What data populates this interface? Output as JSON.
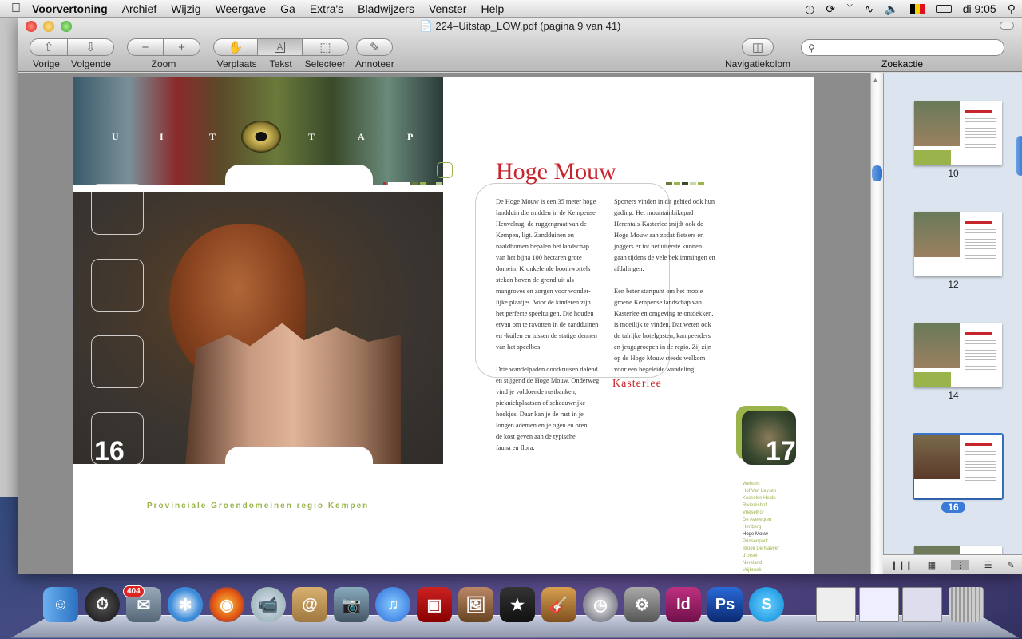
{
  "menubar": {
    "app_name": "Voorvertoning",
    "items": [
      "Archief",
      "Wijzig",
      "Weergave",
      "Ga",
      "Extra's",
      "Bladwijzers",
      "Venster",
      "Help"
    ],
    "clock": "di 9:05"
  },
  "window": {
    "title": "224–Uitstap_LOW.pdf (pagina 9 van 41)"
  },
  "toolbar": {
    "prev_label": "Vorige",
    "next_label": "Volgende",
    "zoom_label": "Zoom",
    "move_label": "Verplaats",
    "text_label": "Tekst",
    "select_label": "Selecteer",
    "annotate_label": "Annoteer",
    "sidebar_label": "Navigatiekolom",
    "search_label": "Zoekactie",
    "search_value": ""
  },
  "left_page": {
    "banner_letters": [
      "U",
      "I",
      "T",
      "S",
      "T",
      "A",
      "P"
    ],
    "page_number": "16",
    "footer": "Provinciale Groendomeinen regio Kempen"
  },
  "right_page": {
    "title": "Hoge Mouw",
    "col1": "De Hoge Mouw is een 35 meter hoge\nlandduin die midden in de Kempense\nHeuvelrug, de ruggengraat van de\nKempen, ligt. Zandduinen en\nnaaldbomen bepalen het landschap\nvan het bijna 100 hectaren grote\ndomein. Kronkelende boomwortels\nsteken boven de grond uit als\nmangroves en zorgen voor wonder-\nlijke plaatjes. Voor de kinderen zijn\nhet perfecte speeltuigen. Die houden\nervan om te ravotten in de zandduinen\nen -kuilen en tussen de statige dennen\nvan het speelbos.\n\nDrie wandelpaden doorkruisen dalend\nen stijgend de Hoge Mouw. Onderweg\nvind je voldoende rustbanken,\npicknickplaatsen of schaduwrijke\nhoekjes. Daar kan je de rust in je\nlongen ademen en je ogen en oren\nde kost geven aan de typische\nfauna en flora.",
    "col2": "Sporters vinden in dit gebied ook hun\ngading. Het  mountainbikepad\nHerentals-Kasterlee snijdt ook de\nHoge Mouw aan zodat fietsers en\njoggers er tot het uiterste kunnen\ngaan tijdens de vele beklimmingen en\nafdalingen.\n\nEen beter startpunt om het mooie\ngroene Kempense landschap van\nKasterlee en omgeving te ontdekken,\nis moeilijk te vinden. Dat weten ook\nde talrijke hotelgasten, kampeerders\nen jeugdgroepen in de regio. Zij zijn\nop de Hoge Mouw steeds welkom\nvoor een begeleide wandeling.",
    "location": "Kasterlee",
    "page_number": "17",
    "nav_items": [
      "Welkom",
      "Hof Van Leysen",
      "Kesselse Heide",
      "Riviereshof",
      "Vrieselhof",
      "De Averegten",
      "Hertberg",
      "Hoge Mouw",
      "Prinsenpark",
      "Broek De Naeyer",
      "d'Ursel",
      "Nereland",
      "Vrijbroek"
    ],
    "nav_current": "Hoge Mouw"
  },
  "sidebar": {
    "thumbnails": [
      {
        "label": "10"
      },
      {
        "label": "12"
      },
      {
        "label": "14"
      },
      {
        "label": "16",
        "selected": true
      }
    ]
  },
  "dock": {
    "mail_badge": "404",
    "apps": [
      "finder-icon",
      "dashboard-icon",
      "mail-icon",
      "safari-icon",
      "firefox-icon",
      "ichat-icon",
      "address-book-icon",
      "iphoto-icon",
      "itunes-icon",
      "photo-booth-icon",
      "preview-icon",
      "imovie-icon",
      "garageband-icon",
      "time-machine-icon",
      "system-preferences-icon",
      "indesign-icon",
      "photoshop-icon",
      "skype-icon",
      "minimized-window-icon",
      "minimized-window-icon",
      "minimized-window-icon",
      "trash-icon"
    ],
    "indesign_label": "Id",
    "photoshop_label": "Ps"
  },
  "colors": {
    "accent_red": "#c8242c",
    "accent_green": "#9ab34a",
    "selection_blue": "#3b7ad7"
  }
}
